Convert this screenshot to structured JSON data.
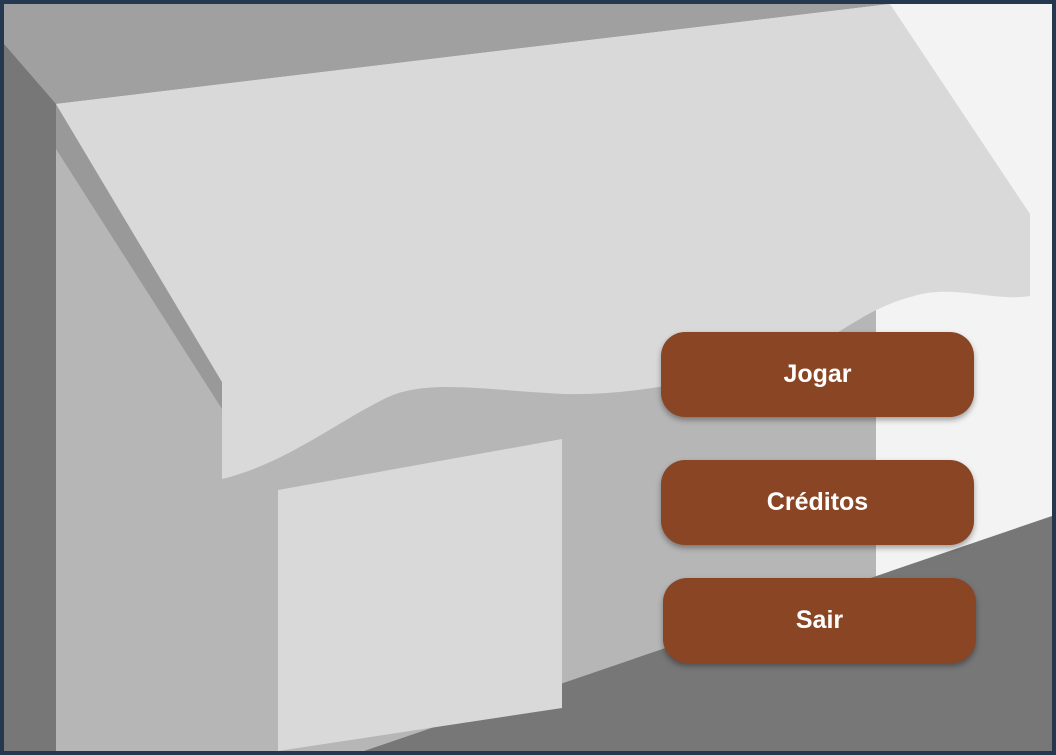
{
  "menu": {
    "play_label": "Jogar",
    "credits_label": "Créditos",
    "exit_label": "Sair"
  },
  "colors": {
    "button": "#8a4525",
    "button_text": "#ffffff",
    "border": "#24394f"
  }
}
